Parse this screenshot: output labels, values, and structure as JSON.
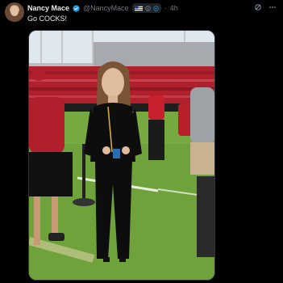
{
  "post": {
    "author_name": "Nancy Mace",
    "handle": "@NancyMace",
    "time": "4h",
    "text": "Go COCKS!"
  },
  "icons": {
    "verified": "verified-badge-icon",
    "flag": "us-flag-icon",
    "info": "info-icon",
    "grok": "grok-icon",
    "more": "more-options-icon"
  },
  "colors": {
    "background": "#000000",
    "verified_blue": "#1d9bf0",
    "secondary_text": "#71767b",
    "primary_text": "#e7e9ea",
    "stadium_red": "#b01f2b",
    "field_green": "#6fa23a"
  }
}
